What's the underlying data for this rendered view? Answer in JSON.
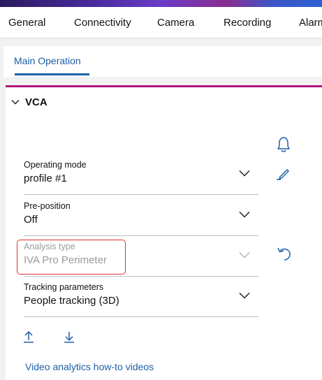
{
  "nav": {
    "tabs": [
      "General",
      "Connectivity",
      "Camera",
      "Recording",
      "Alarm"
    ]
  },
  "subnav": {
    "active_tab": "Main Operation"
  },
  "vca": {
    "section_title": "VCA",
    "fields": [
      {
        "label": "Operating mode",
        "value": "profile #1",
        "enabled": true
      },
      {
        "label": "Pre-position",
        "value": "Off",
        "enabled": true
      },
      {
        "label": "Analysis type",
        "value": "IVA Pro Perimeter",
        "enabled": false
      },
      {
        "label": "Tracking parameters",
        "value": "People tracking (3D)",
        "enabled": true
      }
    ],
    "icons": [
      "bell-icon",
      "edit-icon",
      "undo-icon",
      "upload-icon",
      "download-icon"
    ],
    "help_link": "Video analytics how-to videos"
  },
  "colors": {
    "accent": "#1d5fa8",
    "section_border": "#b0147e",
    "highlight": "#e03030"
  }
}
